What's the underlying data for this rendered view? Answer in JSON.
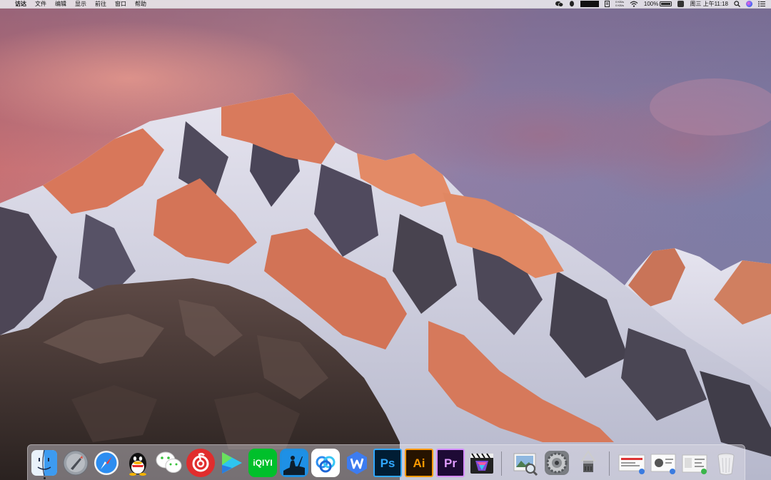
{
  "menubar": {
    "apple_icon": "apple-icon",
    "menus": [
      "访达",
      "文件",
      "编辑",
      "显示",
      "前往",
      "窗口",
      "帮助"
    ],
    "status": {
      "net_up": "0 KB/s",
      "net_down": "0 KB/s",
      "battery_percent": "100%",
      "datetime": "周三 上午11:18",
      "icons": [
        "wechat-icon",
        "qq-icon",
        "net-monitor-icon",
        "file-icon",
        "wifi-icon",
        "battery-icon",
        "notes-icon",
        "search-icon",
        "siri-icon",
        "notification-center-icon"
      ]
    }
  },
  "dock": {
    "apps": [
      {
        "name": "finder-icon",
        "running": true
      },
      {
        "name": "launchpad-icon",
        "running": false
      },
      {
        "name": "safari-icon",
        "running": false
      },
      {
        "name": "qq-icon",
        "running": false
      },
      {
        "name": "wechat-icon",
        "running": false
      },
      {
        "name": "netease-music-icon",
        "running": false
      },
      {
        "name": "video-player-icon",
        "running": false
      },
      {
        "name": "iqiyi-icon",
        "label": "iQIYI",
        "running": false
      },
      {
        "name": "kindle-icon",
        "running": false
      },
      {
        "name": "baidu-netdisk-icon",
        "running": false
      },
      {
        "name": "wps-icon",
        "label": "W",
        "running": false
      },
      {
        "name": "photoshop-icon",
        "label": "Ps",
        "running": false
      },
      {
        "name": "illustrator-icon",
        "label": "Ai",
        "running": false
      },
      {
        "name": "premiere-icon",
        "label": "Pr",
        "running": false
      },
      {
        "name": "final-cut-pro-icon",
        "running": false
      },
      {
        "name": "preview-icon",
        "running": false
      },
      {
        "name": "system-preferences-icon",
        "running": false
      },
      {
        "name": "archive-utility-icon",
        "running": false
      },
      {
        "name": "downloads-stack-icon",
        "running": false
      },
      {
        "name": "documents-stack-icon",
        "running": false
      },
      {
        "name": "folder-stack-icon",
        "running": false
      },
      {
        "name": "trash-icon",
        "running": false
      }
    ]
  }
}
